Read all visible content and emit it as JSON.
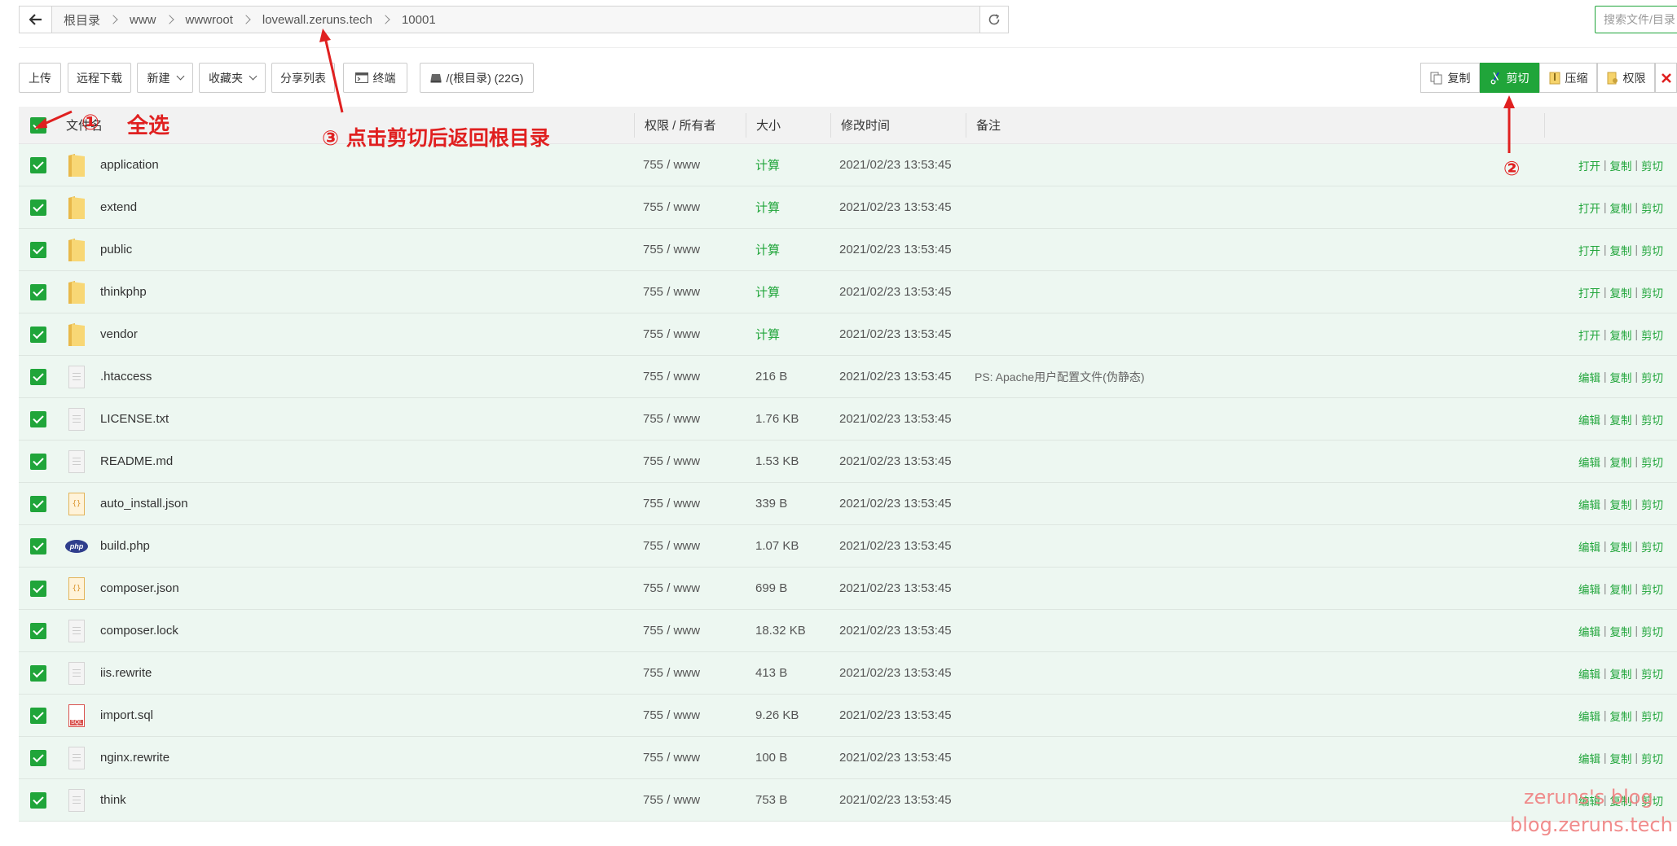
{
  "breadcrumb": {
    "items": [
      "根目录",
      "www",
      "wwwroot",
      "lovewall.zeruns.tech",
      "10001"
    ]
  },
  "search": {
    "placeholder": "搜索文件/目录"
  },
  "toolbar": {
    "upload": "上传",
    "remote_download": "远程下载",
    "new": "新建",
    "favorites": "收藏夹",
    "share_list": "分享列表",
    "terminal": "终端",
    "disk": "/(根目录) (22G)"
  },
  "batch_actions": {
    "copy": "复制",
    "cut": "剪切",
    "compress": "压缩",
    "permission": "权限"
  },
  "table": {
    "headers": {
      "name": "文件名",
      "perm": "权限 / 所有者",
      "size": "大小",
      "mtime": "修改时间",
      "note": "备注"
    },
    "rows": [
      {
        "name": "application",
        "type": "folder",
        "perm": "755 / www",
        "size": "计算",
        "mtime": "2021/02/23 13:53:45",
        "note": "",
        "ops": [
          "打开",
          "复制",
          "剪切"
        ]
      },
      {
        "name": "extend",
        "type": "folder",
        "perm": "755 / www",
        "size": "计算",
        "mtime": "2021/02/23 13:53:45",
        "note": "",
        "ops": [
          "打开",
          "复制",
          "剪切"
        ]
      },
      {
        "name": "public",
        "type": "folder",
        "perm": "755 / www",
        "size": "计算",
        "mtime": "2021/02/23 13:53:45",
        "note": "",
        "ops": [
          "打开",
          "复制",
          "剪切"
        ]
      },
      {
        "name": "thinkphp",
        "type": "folder",
        "perm": "755 / www",
        "size": "计算",
        "mtime": "2021/02/23 13:53:45",
        "note": "",
        "ops": [
          "打开",
          "复制",
          "剪切"
        ]
      },
      {
        "name": "vendor",
        "type": "folder",
        "perm": "755 / www",
        "size": "计算",
        "mtime": "2021/02/23 13:53:45",
        "note": "",
        "ops": [
          "打开",
          "复制",
          "剪切"
        ]
      },
      {
        "name": ".htaccess",
        "type": "file",
        "perm": "755 / www",
        "size": "216 B",
        "mtime": "2021/02/23 13:53:45",
        "note": "PS: Apache用户配置文件(伪静态)",
        "ops": [
          "编辑",
          "复制",
          "剪切"
        ]
      },
      {
        "name": "LICENSE.txt",
        "type": "file",
        "perm": "755 / www",
        "size": "1.76 KB",
        "mtime": "2021/02/23 13:53:45",
        "note": "",
        "ops": [
          "编辑",
          "复制",
          "剪切"
        ]
      },
      {
        "name": "README.md",
        "type": "file",
        "perm": "755 / www",
        "size": "1.53 KB",
        "mtime": "2021/02/23 13:53:45",
        "note": "",
        "ops": [
          "编辑",
          "复制",
          "剪切"
        ]
      },
      {
        "name": "auto_install.json",
        "type": "json",
        "perm": "755 / www",
        "size": "339 B",
        "mtime": "2021/02/23 13:53:45",
        "note": "",
        "ops": [
          "编辑",
          "复制",
          "剪切"
        ]
      },
      {
        "name": "build.php",
        "type": "php",
        "perm": "755 / www",
        "size": "1.07 KB",
        "mtime": "2021/02/23 13:53:45",
        "note": "",
        "ops": [
          "编辑",
          "复制",
          "剪切"
        ]
      },
      {
        "name": "composer.json",
        "type": "json",
        "perm": "755 / www",
        "size": "699 B",
        "mtime": "2021/02/23 13:53:45",
        "note": "",
        "ops": [
          "编辑",
          "复制",
          "剪切"
        ]
      },
      {
        "name": "composer.lock",
        "type": "file",
        "perm": "755 / www",
        "size": "18.32 KB",
        "mtime": "2021/02/23 13:53:45",
        "note": "",
        "ops": [
          "编辑",
          "复制",
          "剪切"
        ]
      },
      {
        "name": "iis.rewrite",
        "type": "file",
        "perm": "755 / www",
        "size": "413 B",
        "mtime": "2021/02/23 13:53:45",
        "note": "",
        "ops": [
          "编辑",
          "复制",
          "剪切"
        ]
      },
      {
        "name": "import.sql",
        "type": "sql",
        "perm": "755 / www",
        "size": "9.26 KB",
        "mtime": "2021/02/23 13:53:45",
        "note": "",
        "ops": [
          "编辑",
          "复制",
          "剪切"
        ]
      },
      {
        "name": "nginx.rewrite",
        "type": "file",
        "perm": "755 / www",
        "size": "100 B",
        "mtime": "2021/02/23 13:53:45",
        "note": "",
        "ops": [
          "编辑",
          "复制",
          "剪切"
        ]
      },
      {
        "name": "think",
        "type": "file",
        "perm": "755 / www",
        "size": "753 B",
        "mtime": "2021/02/23 13:53:45",
        "note": "",
        "ops": [
          "编辑",
          "复制",
          "剪切"
        ]
      }
    ]
  },
  "annotations": {
    "step1_num": "①",
    "step1_text": "全选",
    "step2_num": "②",
    "step3_text": "③ 点击剪切后返回根目录"
  },
  "watermark": {
    "line1": "zeruns's blog",
    "line2": "blog.zeruns.tech"
  },
  "colors": {
    "accent": "#20a53a",
    "annotation": "#e02020"
  }
}
